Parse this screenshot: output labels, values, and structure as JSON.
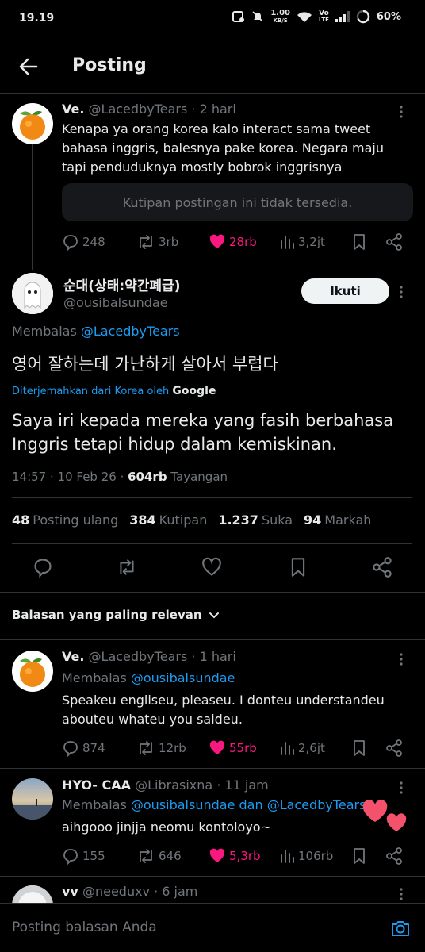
{
  "status": {
    "time": "19.19",
    "speed": "1.00",
    "speed_unit": "KB/S",
    "volte_top": "Vo",
    "volte_bottom": "LTE",
    "battery": "60%"
  },
  "header": {
    "title": "Posting"
  },
  "parent_tweet": {
    "name": "Ve.",
    "handle": "@LacedbyTears",
    "time": "· 2 hari",
    "text": "Kenapa ya orang korea kalo interact sama tweet bahasa inggris, balesnya pake korea. Negara maju tapi penduduknya mostly bobrok inggrisnya",
    "quote_unavailable": "Kutipan postingan ini tidak tersedia.",
    "replies": "248",
    "reposts": "3rb",
    "likes": "28rb",
    "views": "3,2jt"
  },
  "main_tweet": {
    "name": "순대(상태:약간폐급)",
    "handle": "@ousibalsundae",
    "follow_label": "Ikuti",
    "replying_prefix": "Membalas",
    "replying_to": "@LacedbyTears",
    "korean_text": "영어 잘하는데 가난하게 살아서 부럽다",
    "translated_label": "Diterjemahkan dari Korea oleh",
    "translated_by": "Google",
    "translation": "Saya iri kepada mereka yang fasih berbahasa Inggris tetapi hidup dalam kemiskinan.",
    "timestamp": "14:57 · 10 Feb 26 ·",
    "views_count": "604rb",
    "views_label": "Tayangan",
    "stats": [
      {
        "num": "48",
        "label": "Posting ulang"
      },
      {
        "num": "384",
        "label": "Kutipan"
      },
      {
        "num": "1.237",
        "label": "Suka"
      },
      {
        "num": "94",
        "label": "Markah"
      }
    ]
  },
  "sort_label": "Balasan yang paling relevan",
  "replies": [
    {
      "name": "Ve.",
      "handle": "@LacedbyTears",
      "time": "· 1 hari",
      "replying_prefix": "Membalas",
      "replying_to": "@ousibalsundae",
      "text": "Speakeu engliseu, pleaseu. I donteu understandeu abouteu whateu you saideu.",
      "replies": "874",
      "reposts": "12rb",
      "likes": "55rb",
      "views": "2,6jt"
    },
    {
      "name": "HYO- CAA",
      "handle": "@Librasixna",
      "time": "· 11 jam",
      "replying_prefix": "Membalas",
      "replying_to": "@ousibalsundae dan @LacedbyTears",
      "text": "aihgooo jinjja neomu kontoloyo~",
      "replies": "155",
      "reposts": "646",
      "likes": "5,3rb",
      "views": "106rb"
    },
    {
      "name": "vv",
      "handle": "@needuxv",
      "time": "· 6 jam"
    }
  ],
  "composer": {
    "placeholder": "Posting balasan Anda"
  },
  "colors": {
    "accent": "#1d9bf0",
    "like": "#f91880",
    "muted": "#71767b"
  }
}
